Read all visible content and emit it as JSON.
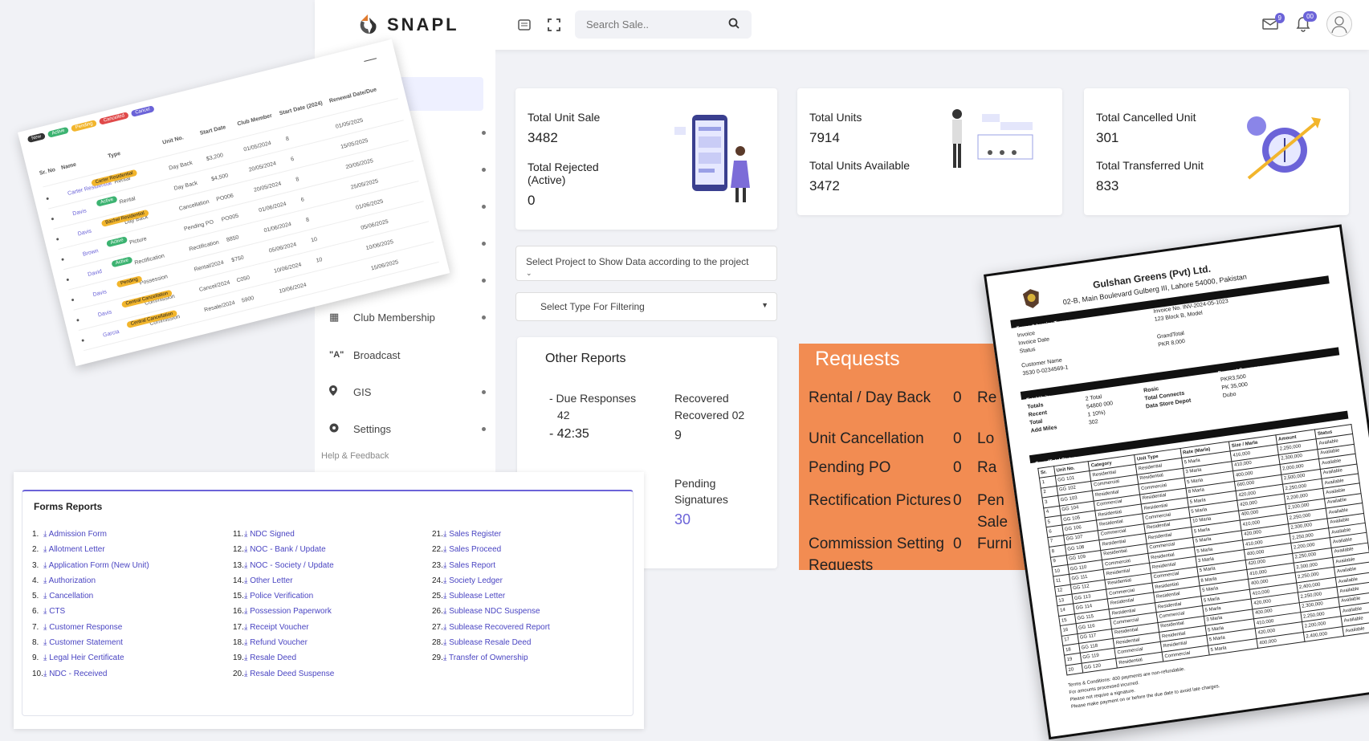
{
  "app": {
    "brand": "SNAPL"
  },
  "header": {
    "search_placeholder": "Search Sale..",
    "mail_badge": "9",
    "bell_badge": "00"
  },
  "sidebar": {
    "active_partial": "ment",
    "partials": [
      "k",
      "eer"
    ],
    "items": [
      {
        "label": "Club Membership",
        "icon": "club-icon"
      },
      {
        "label": "Broadcast",
        "icon": "broadcast-icon"
      },
      {
        "label": "GIS",
        "icon": "location-pin-icon"
      },
      {
        "label": "Settings",
        "icon": "gear-icon"
      }
    ],
    "help": "Help & Feedback"
  },
  "stats": {
    "total_unit_sale_label": "Total Unit Sale",
    "total_unit_sale": "3482",
    "total_rejected_label": "Total Rejected (Active)",
    "total_rejected": "0",
    "total_units_label": "Total Units",
    "total_units": "7914",
    "total_available_label": "Total Units Available",
    "total_available": "3472",
    "total_cancelled_label": "Total Cancelled Unit",
    "total_cancelled": "301",
    "total_transferred_label": "Total Transferred Unit",
    "total_transferred": "833"
  },
  "filters": {
    "project_select": "Select Project to Show Data according to the project",
    "type_select": "Select Type For Filtering"
  },
  "other_reports": {
    "title": "Other Reports",
    "due_label": "- Due Responses",
    "due_value": "42",
    "due_time": "- 42:35",
    "recovered_label": "Recovered",
    "recovered_value": "Recovered 02",
    "recovered_extra": "9",
    "pending_label": "Pending Signatures",
    "pending_value": "30"
  },
  "requests": {
    "title": "Requests",
    "rows": [
      {
        "label": "Rental / Day Back",
        "value": "0",
        "right": "Re"
      },
      {
        "label": "Unit Cancellation",
        "value": "0",
        "right": "Lo"
      },
      {
        "label": "Pending PO",
        "value": "0",
        "right": "Ra"
      },
      {
        "label": "Rectification Pictures",
        "value": "0",
        "right": "Pen"
      },
      {
        "label": "Commission Setting Requests",
        "value": "0",
        "right": "Sale"
      }
    ],
    "extra_right": "Furni"
  },
  "forms_reports": {
    "title": "Forms Reports",
    "col1": [
      "Admission Form",
      "Allotment Letter",
      "Application Form (New Unit)",
      "Authorization",
      "Cancellation",
      "CTS",
      "Customer Response",
      "Customer Statement",
      "Legal Heir Certificate",
      "NDC - Received"
    ],
    "col2": [
      "NDC Signed",
      "NOC - Bank / Update",
      "NOC - Society / Update",
      "Other Letter",
      "Police Verification",
      "Possession Paperwork",
      "Receipt Voucher",
      "Refund Voucher",
      "Resale Deed",
      "Resale Deed Suspense"
    ],
    "col3": [
      "Sales Register",
      "Sales Proceed",
      "Sales Report",
      "Society Ledger",
      "Sublease Letter",
      "Sublease NDC Suspense",
      "Sublease Recovered Report",
      "Sublease Resale Deed",
      "Transfer of Ownership"
    ]
  },
  "table_doc": {
    "filters": [
      "New",
      "Active",
      "Pending",
      "Cancelled",
      "Cancel"
    ],
    "headers": [
      "Sr. No",
      "Name",
      "Type",
      "Unit No.",
      "Start Date",
      "Club Member",
      "Start Date (2024)",
      "Renewal Date/Due"
    ],
    "rows": [
      {
        "name": "Carter Residential",
        "status": "Carter Residential",
        "type": "Rental",
        "unit": "Day Back",
        "amt": "$3,200",
        "date": "01/05/2024",
        "n": "8",
        "ren": "01/05/2025"
      },
      {
        "name": "Davis",
        "status": "Active",
        "type": "Rental",
        "unit": "Day Back",
        "amt": "$4,500",
        "date": "20/05/2024",
        "n": "6",
        "ren": "15/05/2025"
      },
      {
        "name": "Davis",
        "status": "Bachel Residential",
        "type": "Day Back",
        "unit": "Cancellation",
        "amt": "PO006",
        "date": "20/05/2024",
        "n": "8",
        "ren": "20/05/2025"
      },
      {
        "name": "Brown",
        "status": "Active",
        "type": "Picture",
        "unit": "Pending PO",
        "amt": "PO005",
        "date": "01/06/2024",
        "n": "6",
        "ren": "25/05/2025"
      },
      {
        "name": "David",
        "status": "Active",
        "type": "Rectification",
        "unit": "Rectification",
        "amt": "8850",
        "date": "01/06/2024",
        "n": "8",
        "ren": "01/06/2025"
      },
      {
        "name": "Davis",
        "status": "Pending",
        "type": "Possession",
        "unit": "Rental/2024",
        "amt": "$750",
        "date": "05/06/2024",
        "n": "10",
        "ren": "05/06/2025"
      },
      {
        "name": "Davis",
        "status": "Central Cancellation",
        "type": "Commission",
        "unit": "Cancel/2024",
        "amt": "C050",
        "date": "10/06/2024",
        "n": "10",
        "ren": "10/06/2025"
      },
      {
        "name": "Garcia",
        "status": "Central Cancellation",
        "type": "Commission",
        "unit": "Resale/2024",
        "amt": "5900",
        "date": "10/06/2024",
        "n": "",
        "ren": "15/06/2025"
      }
    ]
  },
  "invoice": {
    "company": "Gulshan Greens (Pvt) Ltd.",
    "address": "02-B, Main Boulevard Gulberg III, Lahore 54000, Pakistan",
    "section_bar": "Terms & Invoice Terms",
    "invoice_no": "Invoice No. INV-2024-05-1023",
    "address2": "123 Block B, Model",
    "invoice_label": "Invoice",
    "invoice_date": "Invoice Date",
    "status": "Status",
    "customer": "Customer Name",
    "customer_id": "3530 0-0234569-1",
    "grand_total": "GrandTotal",
    "grand_value": "PKR 8,000",
    "payment_summary": "Payment Summary",
    "total_units": "Total Units",
    "summary_left": [
      "Totals",
      "Recent",
      "Total",
      "Add Miles"
    ],
    "summary_mid": [
      "2 Total",
      "54800 000",
      "1 10%)",
      "302"
    ],
    "summary_right": [
      "Rosic",
      "Total Connects",
      "Data Store Depot"
    ],
    "summary_vals": [
      "PKR3,500",
      "PK 35,000",
      "Dubo"
    ],
    "grand_total_bar": "GrandTotal Status",
    "table_headers": [
      "Sr.",
      "Unit No.",
      "Category",
      "Unit Type",
      "Rate (Marla)",
      "Size / Marla",
      "Amount",
      "Status"
    ],
    "units": [
      "GG 101",
      "GG 102",
      "GG 103",
      "GG 104",
      "GG 105",
      "GG 106",
      "GG 107",
      "GG 108",
      "GG 109",
      "GG 110",
      "GG 111",
      "GG 112",
      "GG 113",
      "GG 114",
      "GG 115",
      "GG 116",
      "GG 117",
      "GG 118",
      "GG 119",
      "GG 120"
    ],
    "categories": [
      "Residential",
      "Commercial",
      "Residential",
      "Commercial",
      "Residential",
      "Residential",
      "Commercial",
      "Residential",
      "Residential",
      "Commercial",
      "Residential",
      "Residential",
      "Commercial",
      "Residential",
      "Residential",
      "Commercial",
      "Residential",
      "Residential",
      "Commercial",
      "Residential"
    ],
    "types": [
      "Residential",
      "Residential",
      "Commercial",
      "Residential",
      "Residential",
      "Commercial",
      "Residential",
      "Residential",
      "Commercial",
      "Residential",
      "Residential",
      "Commercial",
      "Residential",
      "Residential",
      "Residential",
      "Commercial",
      "Residential",
      "Residential",
      "Residential",
      "Commercial"
    ],
    "rates": [
      "5 Marla",
      "3 Marla",
      "5 Marla",
      "8 Marla",
      "5 Marla",
      "5 Marla",
      "10 Marla",
      "5 Marla",
      "5 Marla",
      "5 Marla",
      "3 Marla",
      "5 Marla",
      "8 Marla",
      "5 Marla",
      "5 Marla",
      "5 Marla",
      "3 Marla",
      "5 Marla",
      "5 Marla",
      "5 Marla"
    ],
    "sizes": [
      "416,000",
      "410,000",
      "400,000",
      "660,000",
      "420,000",
      "420,000",
      "400,000",
      "410,000",
      "420,000",
      "410,000",
      "400,000",
      "420,000",
      "410,000",
      "400,000",
      "410,000",
      "420,000",
      "400,000",
      "410,000",
      "420,000",
      "400,000"
    ],
    "amounts": [
      "2,250,000",
      "2,300,000",
      "2,000,000",
      "2,500,000",
      "2,250,000",
      "2,200,000",
      "2,100,000",
      "2,250,000",
      "2,300,000",
      "2,250,000",
      "2,200,000",
      "2,250,000",
      "2,300,000",
      "2,250,000",
      "2,400,000",
      "2,250,000",
      "2,300,000",
      "2,250,000",
      "2,200,000",
      "2,400,000"
    ],
    "statuses": [
      "Available",
      "Available",
      "Available",
      "Available",
      "Available",
      "Available",
      "Available",
      "Available",
      "Available",
      "Available",
      "Available",
      "Available",
      "Available",
      "Available",
      "Available",
      "Available",
      "Available",
      "Available",
      "Available",
      "Available"
    ],
    "terms": [
      "Terms & Conditions: 400 payments are non-refundable.",
      "For amounts processed incurred.",
      "Please not require a signature.",
      "Please make payment on or before the due date to avoid late charges."
    ]
  },
  "colors": {
    "accent": "#6b63d8",
    "requests_bg": "#f28c52",
    "link": "#4a45c2"
  }
}
